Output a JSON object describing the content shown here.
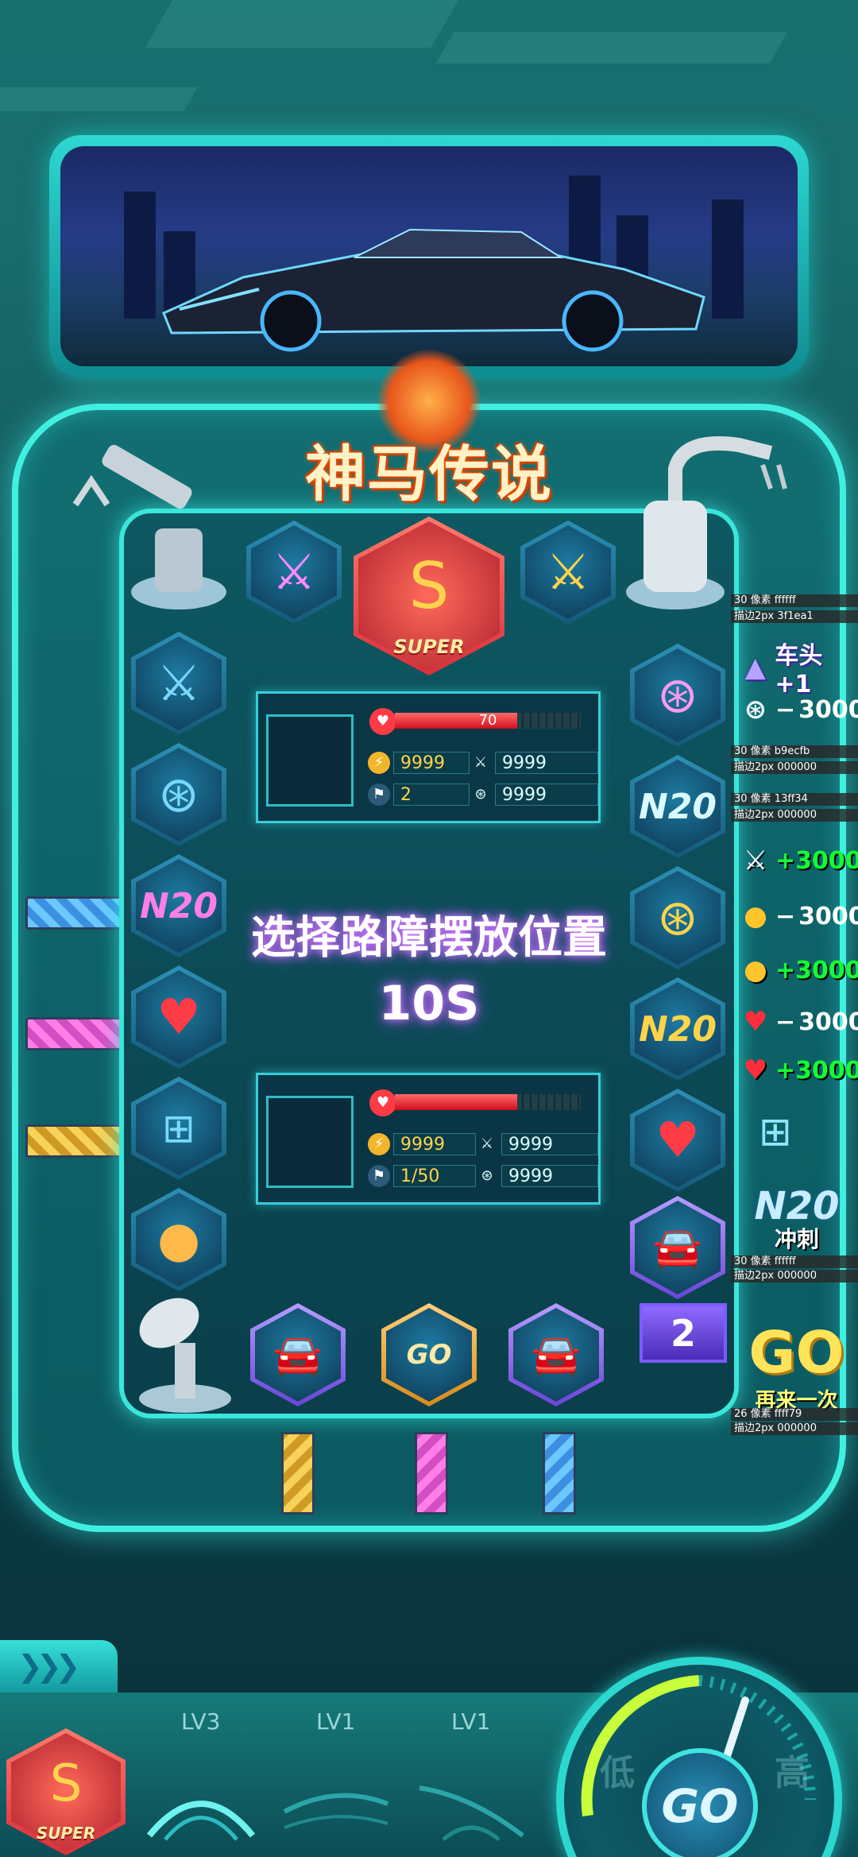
{
  "title": "神马传说",
  "prompt": "选择路障摆放位置",
  "timer": "10S",
  "super_label": "SUPER",
  "player_top": {
    "hp_value": "70",
    "hp_fraction": 0.66,
    "coins": "9999",
    "attack": "9999",
    "flags": "2",
    "wheels": "9999"
  },
  "player_bottom": {
    "hp_value": "",
    "hp_fraction": 0.66,
    "coins": "9999",
    "attack": "9999",
    "flags": "1/50",
    "wheels": "9999"
  },
  "board": {
    "top_row": [
      "sword-pink-icon",
      "super-logo",
      "sword-gold-icon"
    ],
    "left_column": [
      "sword-blue-icon",
      "wheel-blue-icon",
      "n2o-pink-icon",
      "heart-icon",
      "barrier-icon",
      "bomb-icon"
    ],
    "right_column": [
      "wheel-pink-icon",
      "n2o-teal-icon",
      "wheel-gold-icon",
      "n2o-gold-icon",
      "heart-icon",
      "car-badge-icon"
    ],
    "bottom_row": [
      "car-badge-icon",
      "speedometer-go-icon",
      "car-badge-icon"
    ],
    "bottom_gauge_text": "GO",
    "counter_value": "2",
    "n2o_label": "N20"
  },
  "annotations": [
    {
      "text": "30 像素  ffffff"
    },
    {
      "text": "描边2px  3f1ea1"
    },
    {
      "text": "30 像素   b9ecfb"
    },
    {
      "text": "描边2px 000000"
    },
    {
      "text": "30 像素    13ff34"
    },
    {
      "text": "描边2px 000000"
    },
    {
      "text": "30 像素  ffffff"
    },
    {
      "text": "描边2px 000000"
    },
    {
      "text": "26 像素    ffff79"
    },
    {
      "text": "描边2px 000000"
    }
  ],
  "legend": {
    "head_plus": "车头+1",
    "wheel_minus": "3000",
    "item_plus_a": "+3000",
    "coin_minus": "3000",
    "coin_plus": "+3000",
    "heart_minus": "3000",
    "heart_plus": "+3000",
    "n2o_text": "N20",
    "sprint": "冲刺",
    "go_big": "GO",
    "retry": "再来一次"
  },
  "bottom": {
    "super_label": "SUPER",
    "slots": [
      {
        "level": "LV3"
      },
      {
        "level": "LV1"
      },
      {
        "level": "LV1"
      }
    ],
    "gauge_low": "低",
    "gauge_high": "高",
    "go_label": "GO"
  },
  "colors": {
    "accent": "#3ff0e0",
    "hp": "#e0141f",
    "prompt_glow": "#b34dff",
    "plus_green": "#13ff34",
    "lane_blue": "#5ab8ff",
    "lane_pink": "#ff5fe0",
    "lane_gold": "#f2c43a"
  }
}
